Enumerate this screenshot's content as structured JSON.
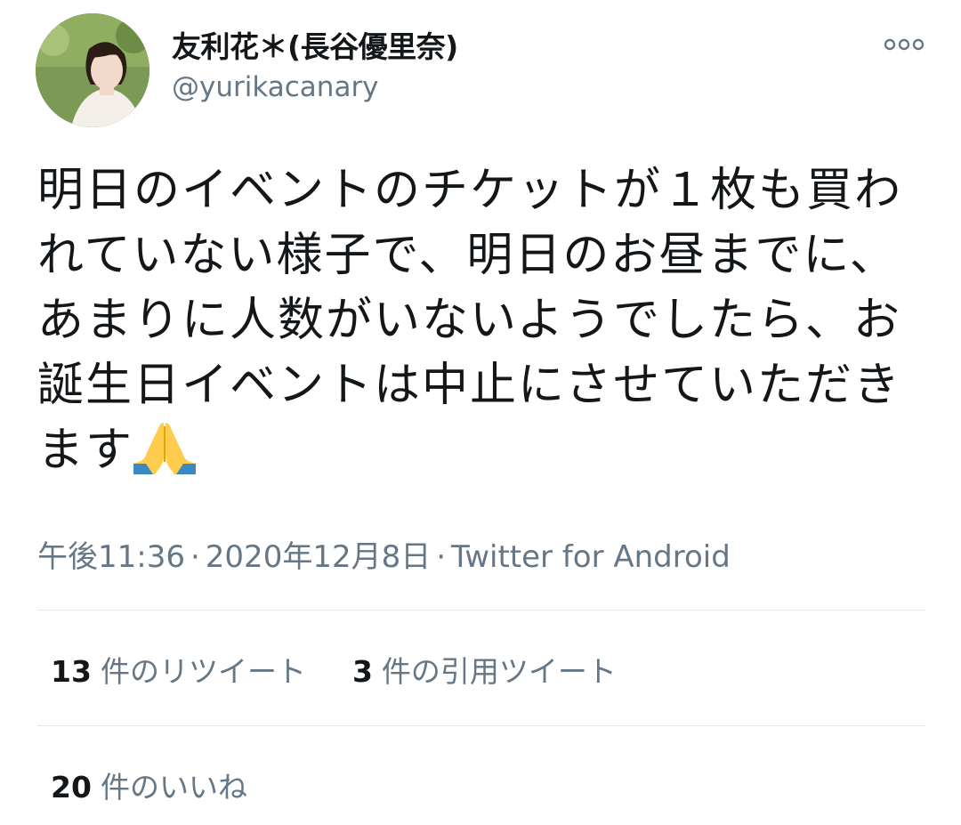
{
  "user": {
    "display_name": "友利花＊(長谷優里奈)",
    "handle": "@yurikacanary",
    "avatar_icon": "profile-photo"
  },
  "tweet": {
    "text": "明日のイベントのチケットが１枚も買われていない様子で、明日のお昼までに、あまりに人数がいないようでしたら、お誕生日イベントは中止にさせていただきます",
    "emoji": "folded-hands",
    "time": "午後11:36",
    "separator": "·",
    "date": "2020年12月8日",
    "source": "Twitter for Android"
  },
  "stats": {
    "retweets_count": "13",
    "retweets_label": "件のリツイート",
    "quotes_count": "3",
    "quotes_label": "件の引用ツイート",
    "likes_count": "20",
    "likes_label": "件のいいね"
  },
  "colors": {
    "text_primary": "#14171a",
    "text_secondary": "#657786",
    "divider": "#e1e8ed"
  },
  "more_icon": "more-horizontal"
}
